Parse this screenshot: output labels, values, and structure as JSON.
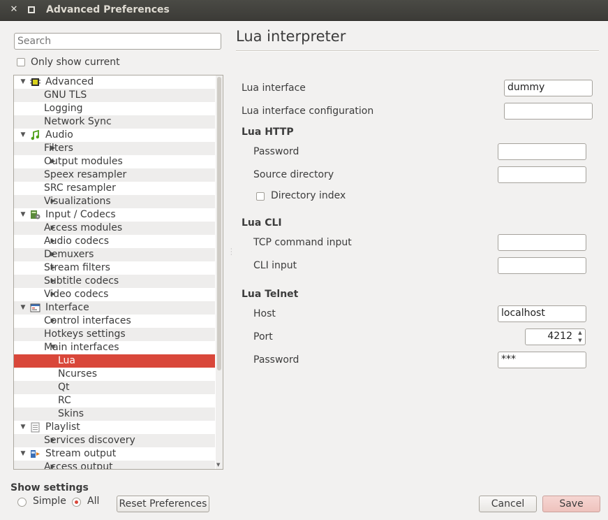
{
  "window": {
    "title": "Advanced Preferences"
  },
  "search": {
    "placeholder": "Search"
  },
  "only_show_current": "Only show current",
  "tree": [
    {
      "label": "Advanced",
      "level": 0,
      "expander": "open",
      "icon": "chip-icon"
    },
    {
      "label": "GNU TLS",
      "level": 1,
      "expander": "none"
    },
    {
      "label": "Logging",
      "level": 1,
      "expander": "none"
    },
    {
      "label": "Network Sync",
      "level": 1,
      "expander": "none"
    },
    {
      "label": "Audio",
      "level": 0,
      "expander": "open",
      "icon": "music-note-icon"
    },
    {
      "label": "Filters",
      "level": 1,
      "expander": "closed"
    },
    {
      "label": "Output modules",
      "level": 1,
      "expander": "closed"
    },
    {
      "label": "Speex resampler",
      "level": 1,
      "expander": "none"
    },
    {
      "label": "SRC resampler",
      "level": 1,
      "expander": "none"
    },
    {
      "label": "Visualizations",
      "level": 1,
      "expander": "closed"
    },
    {
      "label": "Input / Codecs",
      "level": 0,
      "expander": "open",
      "icon": "codec-icon"
    },
    {
      "label": "Access modules",
      "level": 1,
      "expander": "closed"
    },
    {
      "label": "Audio codecs",
      "level": 1,
      "expander": "closed"
    },
    {
      "label": "Demuxers",
      "level": 1,
      "expander": "closed"
    },
    {
      "label": "Stream filters",
      "level": 1,
      "expander": "closed"
    },
    {
      "label": "Subtitle codecs",
      "level": 1,
      "expander": "closed"
    },
    {
      "label": "Video codecs",
      "level": 1,
      "expander": "closed"
    },
    {
      "label": "Interface",
      "level": 0,
      "expander": "open",
      "icon": "interface-icon"
    },
    {
      "label": "Control interfaces",
      "level": 1,
      "expander": "closed"
    },
    {
      "label": "Hotkeys settings",
      "level": 1,
      "expander": "none"
    },
    {
      "label": "Main interfaces",
      "level": 1,
      "expander": "open"
    },
    {
      "label": "Lua",
      "level": 2,
      "expander": "none",
      "selected": true
    },
    {
      "label": "Ncurses",
      "level": 2,
      "expander": "none"
    },
    {
      "label": "Qt",
      "level": 2,
      "expander": "none"
    },
    {
      "label": "RC",
      "level": 2,
      "expander": "none"
    },
    {
      "label": "Skins",
      "level": 2,
      "expander": "none"
    },
    {
      "label": "Playlist",
      "level": 0,
      "expander": "open",
      "icon": "playlist-icon"
    },
    {
      "label": "Services discovery",
      "level": 1,
      "expander": "closed"
    },
    {
      "label": "Stream output",
      "level": 0,
      "expander": "open",
      "icon": "stream-output-icon"
    },
    {
      "label": "Access output",
      "level": 1,
      "expander": "closed"
    }
  ],
  "panel": {
    "title": "Lua interpreter",
    "lua_interface_label": "Lua interface",
    "lua_interface_value": "dummy",
    "lua_interface_config_label": "Lua interface configuration",
    "lua_interface_config_value": "",
    "http_group": "Lua HTTP",
    "http_password_label": "Password",
    "http_password_value": "",
    "source_dir_label": "Source directory",
    "source_dir_value": "",
    "dir_index_label": "Directory index",
    "cli_group": "Lua CLI",
    "tcp_label": "TCP command input",
    "tcp_value": "",
    "cli_input_label": "CLI input",
    "cli_input_value": "",
    "telnet_group": "Lua Telnet",
    "host_label": "Host",
    "host_value": "localhost",
    "port_label": "Port",
    "port_value": "4212",
    "telnet_password_label": "Password",
    "telnet_password_value": "***"
  },
  "footer": {
    "show_settings": "Show settings",
    "simple": "Simple",
    "all": "All",
    "reset": "Reset Preferences",
    "cancel": "Cancel",
    "save": "Save"
  },
  "colors": {
    "accent": "#d9473a",
    "titlebar": "#3c3b37"
  }
}
